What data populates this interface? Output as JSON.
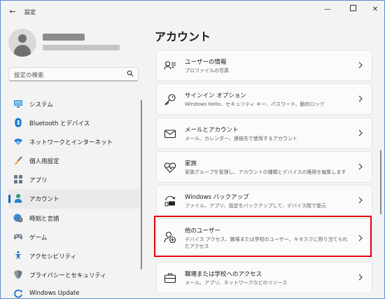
{
  "window": {
    "title": "設定",
    "back_icon": "arrow-left-icon"
  },
  "search": {
    "placeholder": "設定の検索"
  },
  "sidebar": {
    "items": [
      {
        "label": "システム",
        "icon": "monitor-icon"
      },
      {
        "label": "Bluetooth とデバイス",
        "icon": "bluetooth-icon"
      },
      {
        "label": "ネットワークとインターネット",
        "icon": "wifi-icon"
      },
      {
        "label": "個人用設定",
        "icon": "brush-icon"
      },
      {
        "label": "アプリ",
        "icon": "apps-icon"
      },
      {
        "label": "アカウント",
        "icon": "person-icon",
        "selected": true
      },
      {
        "label": "時刻と言語",
        "icon": "clock-globe-icon"
      },
      {
        "label": "ゲーム",
        "icon": "gamepad-icon"
      },
      {
        "label": "アクセシビリティ",
        "icon": "accessibility-icon"
      },
      {
        "label": "プライバシーとセキュリティ",
        "icon": "shield-icon"
      },
      {
        "label": "Windows Update",
        "icon": "update-icon"
      }
    ]
  },
  "main": {
    "title": "アカウント",
    "cards": [
      {
        "title": "ユーザーの情報",
        "desc": "プロファイルの写真",
        "icon": "user-info-icon"
      },
      {
        "title": "サインイン オプション",
        "desc": "Windows Hello、セキュリティ キー、パスワード、動的ロック",
        "icon": "key-icon"
      },
      {
        "title": "メールとアカウント",
        "desc": "メール、カレンダー、連絡先で使用するアカウント",
        "icon": "mail-icon"
      },
      {
        "title": "家族",
        "desc": "家族グループを管理し、アカウントの種類とデバイスの権限を編集します",
        "icon": "family-heart-icon"
      },
      {
        "title": "Windows バックアップ",
        "desc": "ファイル、アプリ、設定をバックアップして、デバイス間で復元",
        "icon": "backup-icon"
      },
      {
        "title": "他のユーザー",
        "desc": "デバイス アクセス、職場または学校のユーザー、キオスクに割り当てられたアクセス",
        "icon": "add-user-icon",
        "highlighted": true
      },
      {
        "title": "職場または学校へのアクセス",
        "desc": "メール、アプリ、ネットワークなどのリソース",
        "icon": "briefcase-icon"
      }
    ]
  },
  "colors": {
    "accent": "#0067c0",
    "highlight": "#e60012",
    "background": "#f3f3f3",
    "card": "#fbfbfb"
  }
}
